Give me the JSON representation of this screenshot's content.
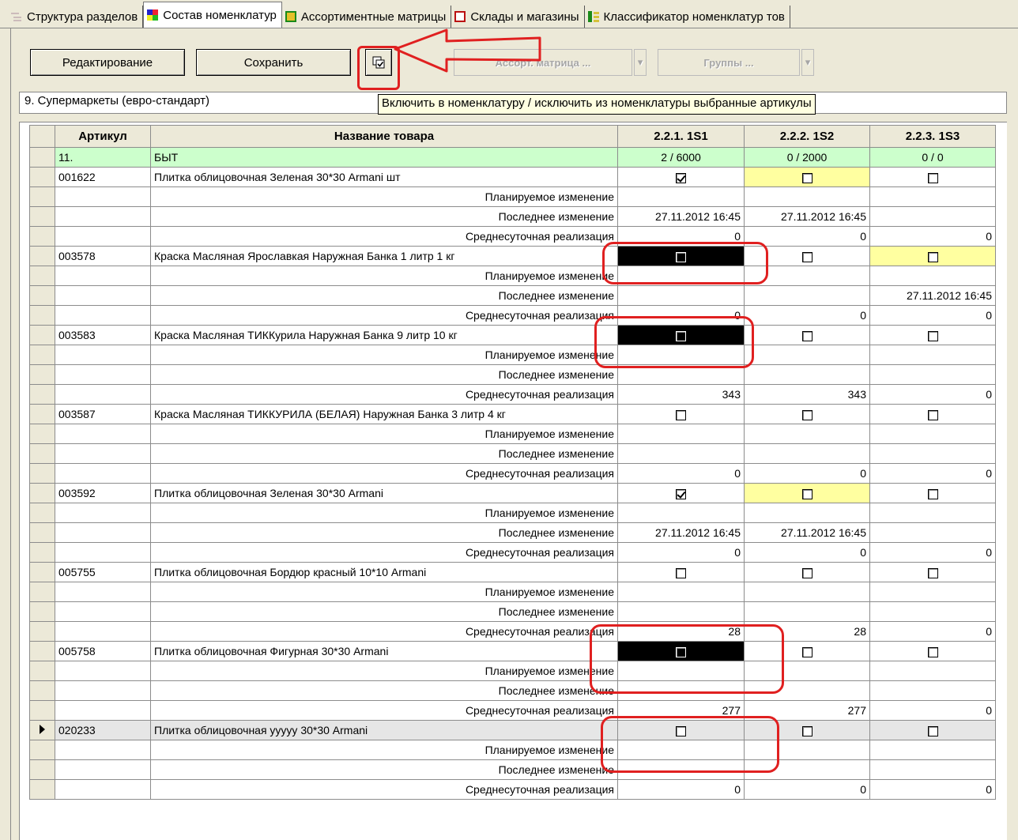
{
  "tabs": [
    {
      "label": "Структура разделов",
      "icon": "structure-icon"
    },
    {
      "label": "Состав номенклатур",
      "icon": "nomenclature-icon",
      "active": true
    },
    {
      "label": "Ассортиментные матрицы",
      "icon": "matrix-icon"
    },
    {
      "label": "Склады и магазины",
      "icon": "store-icon"
    },
    {
      "label": "Классификатор номенклатур тов",
      "icon": "classifier-icon"
    }
  ],
  "toolbar": {
    "edit_label": "Редактирование",
    "save_label": "Сохранить",
    "include_icon": "include-exclude-icon",
    "matrix_label": "Ассорт. матрица ...",
    "groups_label": "Группы ..."
  },
  "section_label": "9. Супермаркеты (евро-стандарт)",
  "tooltip": "Включить в номенклатуру / исключить из номенклатуры выбранные артикулы",
  "grid": {
    "headers": [
      "Артикул",
      "Название товара",
      "2.2.1. 1S1",
      "2.2.2. 1S2",
      "2.2.3. 1S3"
    ],
    "group": {
      "code": "11.",
      "name": "БЫТ",
      "c1": "2 / 6000",
      "c2": "0 / 2000",
      "c3": "0 / 0"
    },
    "sublabels": {
      "planned": "Планируемое изменение",
      "last": "Последнее изменение",
      "avg": "Среднесуточная реализация"
    },
    "items": [
      {
        "code": "001622",
        "name": "Плитка облицовочная Зеленая 30*30 Armani шт",
        "last": [
          "27.11.2012 16:45",
          "27.11.2012 16:45",
          ""
        ],
        "avg": [
          "0",
          "0",
          "0"
        ]
      },
      {
        "code": "003578",
        "name": "Краска Масляная Ярославкая Наружная Банка 1 литр 1 кг",
        "last": [
          "",
          "",
          "27.11.2012 16:45"
        ],
        "avg": [
          "0",
          "0",
          "0"
        ]
      },
      {
        "code": "003583",
        "name": "Краска Масляная ТИККурила Наружная Банка 9 литр 10 кг",
        "last": [
          "",
          "",
          ""
        ],
        "avg": [
          "343",
          "343",
          "0"
        ]
      },
      {
        "code": "003587",
        "name": "Краска Масляная ТИККУРИЛА (БЕЛАЯ) Наружная Банка 3 литр 4 кг",
        "last": [
          "",
          "",
          ""
        ],
        "avg": [
          "0",
          "0",
          "0"
        ]
      },
      {
        "code": "003592",
        "name": "Плитка облицовочная Зеленая 30*30 Armani",
        "last": [
          "27.11.2012 16:45",
          "27.11.2012 16:45",
          ""
        ],
        "avg": [
          "0",
          "0",
          "0"
        ]
      },
      {
        "code": "005755",
        "name": "Плитка облицовочная Бордюр красный 10*10 Armani",
        "last": [
          "",
          "",
          ""
        ],
        "avg": [
          "28",
          "28",
          "0"
        ]
      },
      {
        "code": "005758",
        "name": "Плитка облицовочная Фигурная 30*30 Armani",
        "last": [
          "",
          "",
          ""
        ],
        "avg": [
          "277",
          "277",
          "0"
        ]
      },
      {
        "code": "020233",
        "name": "Плитка облицовочная ууууу 30*30 Armani",
        "last": [
          "",
          "",
          ""
        ],
        "avg": [
          "0",
          "0",
          "0"
        ]
      }
    ]
  },
  "colors": {
    "annotation": "#e02020",
    "group_row": "#ccffcc",
    "highlight_yellow": "#ffffa0",
    "tooltip_bg": "#ffffe1"
  }
}
